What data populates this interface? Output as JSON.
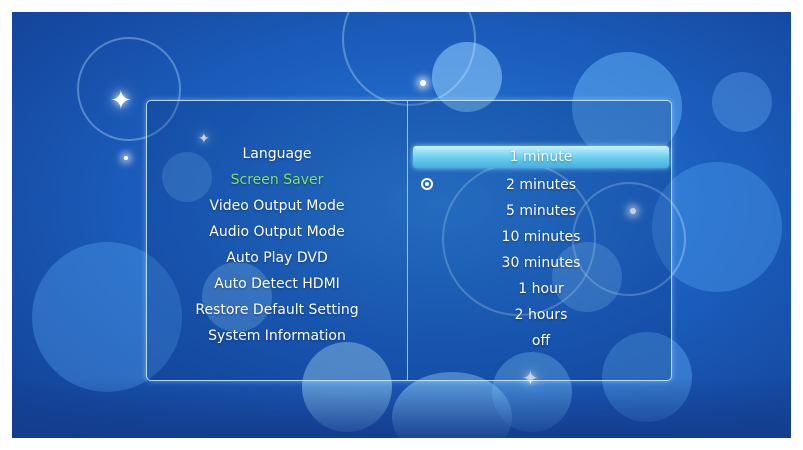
{
  "settings_menu": {
    "items": [
      {
        "label": "Language"
      },
      {
        "label": "Screen Saver",
        "active": true
      },
      {
        "label": "Video Output Mode"
      },
      {
        "label": "Audio Output Mode"
      },
      {
        "label": "Auto Play DVD"
      },
      {
        "label": "Auto Detect HDMI"
      },
      {
        "label": "Restore Default Setting"
      },
      {
        "label": "System Information"
      }
    ]
  },
  "options": {
    "highlighted": "1 minute",
    "selected": "2 minutes",
    "items": [
      {
        "label": "1 minute"
      },
      {
        "label": "2 minutes"
      },
      {
        "label": "5 minutes"
      },
      {
        "label": "10 minutes"
      },
      {
        "label": "30 minutes"
      },
      {
        "label": "1 hour"
      },
      {
        "label": "2 hours"
      },
      {
        "label": "off"
      }
    ]
  },
  "icons": {
    "selected_marker": "radio-selected-icon",
    "decoration": "sparkle-icon"
  },
  "colors": {
    "background": "#1c5fbf",
    "active_menu_text": "#7ee068",
    "highlight_bar": "#6fd0f0",
    "text": "#ffffff",
    "panel_border": "#d2f0ff"
  }
}
